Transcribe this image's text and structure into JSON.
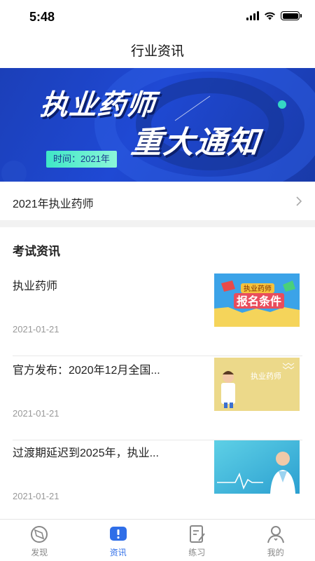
{
  "status": {
    "time": "5:48"
  },
  "nav": {
    "title": "行业资讯"
  },
  "banner": {
    "line1": "执业药师",
    "line2": "重大通知",
    "date_label": "时间：2021年"
  },
  "link_row": {
    "label": "2021年执业药师"
  },
  "section": {
    "title": "考试资讯"
  },
  "news": [
    {
      "title": "执业药师",
      "date": "2021-01-21",
      "thumb_text1": "执业药师",
      "thumb_text2": "报名条件"
    },
    {
      "title": "官方发布：2020年12月全国...",
      "date": "2021-01-21",
      "thumb_text1": "执业药师"
    },
    {
      "title": "过渡期延迟到2025年，执业...",
      "date": "2021-01-21"
    }
  ],
  "tabs": [
    {
      "label": "发现",
      "icon": "discover-icon"
    },
    {
      "label": "资讯",
      "icon": "news-icon",
      "active": true
    },
    {
      "label": "练习",
      "icon": "practice-icon"
    },
    {
      "label": "我的",
      "icon": "profile-icon"
    }
  ],
  "colors": {
    "accent": "#2f6ee8",
    "banner_blue": "#1f49d4",
    "date_teal": "#3fe7c6"
  }
}
